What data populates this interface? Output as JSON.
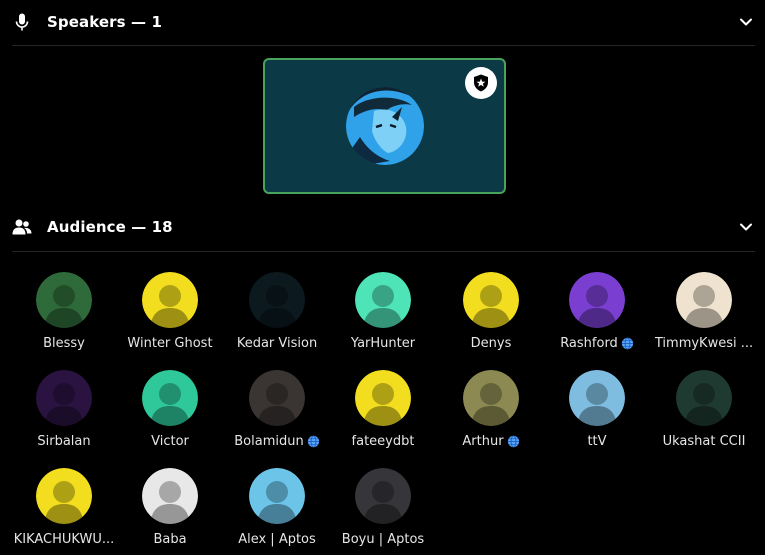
{
  "speakers": {
    "title": "Speakers — 1",
    "icon": "microphone-icon",
    "collapse_icon": "chevron-down-icon",
    "card": {
      "badge_icon": "shield-star-icon",
      "border": "#4aa35a",
      "background": "#0b3945"
    }
  },
  "audience": {
    "title": "Audience — 18",
    "icon": "people-icon",
    "collapse_icon": "chevron-down-icon",
    "members": [
      {
        "name": "Blessy",
        "bg": "#2f6b3a"
      },
      {
        "name": "Winter Ghost",
        "bg": "#f2de1e"
      },
      {
        "name": "Kedar Vision",
        "bg": "#0c1a1f"
      },
      {
        "name": "YarHunter",
        "bg": "#4fe3b8"
      },
      {
        "name": "Denys",
        "bg": "#f2de1e"
      },
      {
        "name": "Rashford",
        "bg": "#7a3fd1",
        "badge": "globe-icon"
      },
      {
        "name": "TimmyKwesi ...",
        "bg": "#efe3cf"
      },
      {
        "name": "Sirbalan",
        "bg": "#2a1340"
      },
      {
        "name": "Victor",
        "bg": "#2ec89a"
      },
      {
        "name": "Bolamidun",
        "bg": "#3a3533",
        "badge": "globe-icon"
      },
      {
        "name": "fateeydbt",
        "bg": "#f2de1e"
      },
      {
        "name": "Arthur",
        "bg": "#8c8a52",
        "badge": "globe-icon"
      },
      {
        "name": "ttV",
        "bg": "#7fbde0"
      },
      {
        "name": "Ukashat CCII",
        "bg": "#1f3a30"
      },
      {
        "name": "KIKACHUKWU...",
        "bg": "#f2de1e"
      },
      {
        "name": "Baba",
        "bg": "#e8e8e8"
      },
      {
        "name": "Alex | Aptos",
        "bg": "#6cc4e8"
      },
      {
        "name": "Boyu | Aptos",
        "bg": "#35353a"
      }
    ]
  }
}
